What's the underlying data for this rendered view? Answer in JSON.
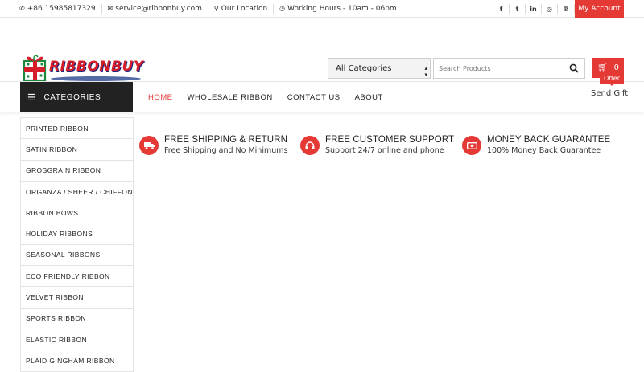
{
  "topbar": {
    "phone": "+86 15985817329",
    "email": "service@ribbonbuy.com",
    "location": "Our Location",
    "hours": "Working Hours - 10am - 06pm",
    "social": [
      "facebook-icon",
      "twitter-icon",
      "linkedin-icon",
      "instagram-icon",
      "pinterest-icon"
    ],
    "account_label": "My Account"
  },
  "header": {
    "logo_text": "RIBBONBUY",
    "category_select": "All Categories",
    "search_placeholder": "Search Products",
    "cart_count": "0"
  },
  "nav": {
    "categories_label": "CATEGORIES",
    "menu": [
      "HOME",
      "WHOLESALE RIBBON",
      "CONTACT US",
      "ABOUT"
    ],
    "active": "HOME",
    "offer_badge": "Offer",
    "send_gift": "Send Gift"
  },
  "categories": [
    "PRINTED RIBBON",
    "SATIN RIBBON",
    "GROSGRAIN RIBBON",
    "ORGANZA / SHEER / CHIFFON",
    "RIBBON BOWS",
    "HOLIDAY RIBBONS",
    "SEASONAL RIBBONS",
    "ECO FRIENDLY RIBBON",
    "VELVET RIBBON",
    "SPORTS RIBBON",
    "ELASTIC RIBBON",
    "PLAID GINGHAM RIBBON"
  ],
  "features": [
    {
      "title": "FREE SHIPPING & RETURN",
      "desc": "Free Shipping and No Minimums",
      "icon": "truck-icon"
    },
    {
      "title": "FREE CUSTOMER SUPPORT",
      "desc": "Support 24/7 online and phone",
      "icon": "headset-icon"
    },
    {
      "title": "MONEY BACK GUARANTEE",
      "desc": "100% Money Back Guarantee",
      "icon": "money-icon"
    }
  ],
  "colors": {
    "accent": "#e53935",
    "dark": "#222222"
  }
}
